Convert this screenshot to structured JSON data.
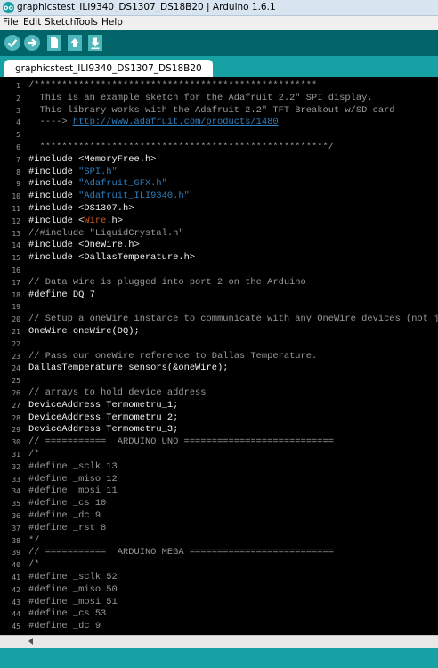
{
  "window": {
    "title": "graphicstest_ILI9340_DS1307_DS18B20 | Arduino 1.6.1",
    "icon_label": "oo"
  },
  "menu": [
    {
      "label": "File"
    },
    {
      "label": "Edit"
    },
    {
      "label": "Sketch"
    },
    {
      "label": "Tools"
    },
    {
      "label": "Help"
    }
  ],
  "toolbar": {
    "buttons": [
      "verify-icon",
      "upload-icon",
      "new-icon",
      "open-icon",
      "save-icon"
    ]
  },
  "tabs": [
    {
      "label": "graphicstest_ILI9340_DS1307_DS18B20"
    }
  ],
  "colors": {
    "toolbar": "#006468",
    "tabbar": "#17a1a5",
    "button": "#4db7bb",
    "editor_bg": "#000000",
    "comment": "#9a9a9a",
    "string": "#2e7fbf",
    "keyword": "#ce5a1c"
  },
  "code_lines": [
    [
      [
        "c",
        "/***************************************************"
      ]
    ],
    [
      [
        "c",
        "  This is an example sketch for the Adafruit 2.2\" SPI display."
      ]
    ],
    [
      [
        "c",
        "  This library works with the Adafruit 2.2\" TFT Breakout w/SD card"
      ]
    ],
    [
      [
        "c",
        "  ----> "
      ],
      [
        "l",
        "http://www.adafruit.com/products/1480"
      ]
    ],
    [
      [
        "n",
        ""
      ]
    ],
    [
      [
        "c",
        "  ****************************************************/"
      ]
    ],
    [
      [
        "n",
        "#include <MemoryFree.h>"
      ]
    ],
    [
      [
        "n",
        "#include "
      ],
      [
        "s",
        "\"SPI.h\""
      ]
    ],
    [
      [
        "n",
        "#include "
      ],
      [
        "s",
        "\"Adafruit_GFX.h\""
      ]
    ],
    [
      [
        "n",
        "#include "
      ],
      [
        "s",
        "\"Adafruit_ILI9340.h\""
      ]
    ],
    [
      [
        "n",
        "#include <DS1307.h>"
      ]
    ],
    [
      [
        "n",
        "#include <"
      ],
      [
        "k",
        "Wire"
      ],
      [
        "n",
        ".h>"
      ]
    ],
    [
      [
        "c",
        "//#include \"LiquidCrystal.h\""
      ]
    ],
    [
      [
        "n",
        "#include <OneWire.h>"
      ]
    ],
    [
      [
        "n",
        "#include <DallasTemperature.h>"
      ]
    ],
    [
      [
        "n",
        ""
      ]
    ],
    [
      [
        "c",
        "// Data wire is plugged into port 2 on the Arduino"
      ]
    ],
    [
      [
        "n",
        "#define DQ 7"
      ]
    ],
    [
      [
        "n",
        ""
      ]
    ],
    [
      [
        "c",
        "// Setup a oneWire instance to communicate with any OneWire devices (not just Max"
      ]
    ],
    [
      [
        "n",
        "OneWire oneWire(DQ);"
      ]
    ],
    [
      [
        "n",
        ""
      ]
    ],
    [
      [
        "c",
        "// Pass our oneWire reference to Dallas Temperature."
      ]
    ],
    [
      [
        "n",
        "DallasTemperature sensors(&oneWire);"
      ]
    ],
    [
      [
        "n",
        ""
      ]
    ],
    [
      [
        "c",
        "// arrays to hold device address"
      ]
    ],
    [
      [
        "n",
        "DeviceAddress Termometru_1;"
      ]
    ],
    [
      [
        "n",
        "DeviceAddress Termometru_2;"
      ]
    ],
    [
      [
        "n",
        "DeviceAddress Termometru_3;"
      ]
    ],
    [
      [
        "c",
        "// ===========  ARDUINO UNO ==========================="
      ]
    ],
    [
      [
        "c",
        "/*"
      ]
    ],
    [
      [
        "c",
        "#define _sclk 13"
      ]
    ],
    [
      [
        "c",
        "#define _miso 12"
      ]
    ],
    [
      [
        "c",
        "#define _mosi 11"
      ]
    ],
    [
      [
        "c",
        "#define _cs 10"
      ]
    ],
    [
      [
        "c",
        "#define _dc 9"
      ]
    ],
    [
      [
        "c",
        "#define _rst 8"
      ]
    ],
    [
      [
        "c",
        "*/"
      ]
    ],
    [
      [
        "c",
        "// ===========  ARDUINO MEGA =========================="
      ]
    ],
    [
      [
        "c",
        "/*"
      ]
    ],
    [
      [
        "c",
        "#define _sclk 52"
      ]
    ],
    [
      [
        "c",
        "#define _miso 50"
      ]
    ],
    [
      [
        "c",
        "#define _mosi 51"
      ]
    ],
    [
      [
        "c",
        "#define _cs 53"
      ]
    ],
    [
      [
        "c",
        "#define _dc 9"
      ]
    ]
  ]
}
